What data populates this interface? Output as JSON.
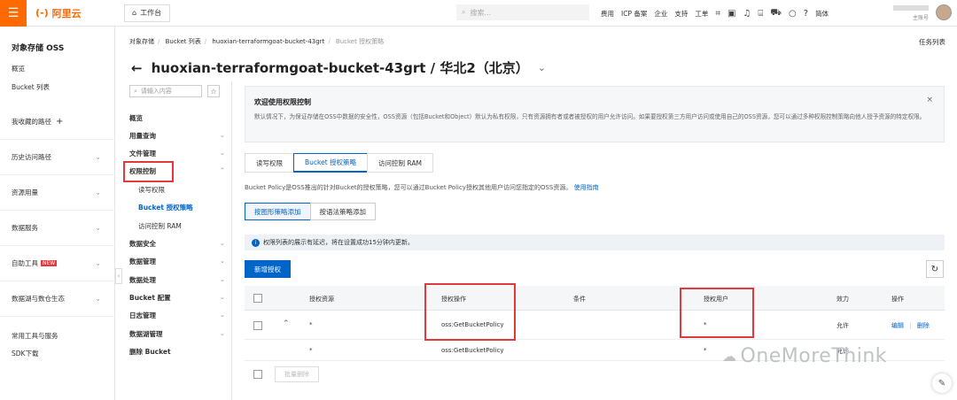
{
  "topbar": {
    "logo_text": "阿里云",
    "logo_mark": "(-)",
    "workbench": "工作台",
    "search_placeholder": "搜索...",
    "nav": [
      "费用",
      "ICP 备案",
      "企业",
      "支持",
      "工单"
    ],
    "lang": "简体",
    "account_sub": "主账号"
  },
  "side1": {
    "title": "对象存储 OSS",
    "items": [
      "概览",
      "Bucket 列表"
    ],
    "groups": [
      {
        "label": "我收藏的路径",
        "suffix": "+"
      },
      {
        "label": "历史访问路径"
      },
      {
        "label": "资源用量"
      },
      {
        "label": "数据服务"
      },
      {
        "label": "自助工具",
        "badge": "NEW"
      },
      {
        "label": "数据湖与数仓生态"
      }
    ],
    "bottom": [
      "常用工具与服务",
      "SDK下载"
    ]
  },
  "breadcrumb": [
    "对象存储",
    "Bucket 列表",
    "huoxian-terraformgoat-bucket-43grt",
    "Bucket 授权策略"
  ],
  "task_list": "任务列表",
  "page_title": "huoxian-terraformgoat-bucket-43grt / 华北2（北京）",
  "side2": {
    "search_placeholder": "请输入内容",
    "items": [
      {
        "label": "概览"
      },
      {
        "label": "用量查询"
      },
      {
        "label": "文件管理"
      },
      {
        "label": "权限控制"
      },
      {
        "label": "数据安全"
      },
      {
        "label": "数据管理"
      },
      {
        "label": "数据处理"
      },
      {
        "label": "Bucket 配置"
      },
      {
        "label": "日志管理"
      },
      {
        "label": "数据湖管理"
      },
      {
        "label": "删除 Bucket"
      }
    ],
    "sub_items": [
      "读写权限",
      "Bucket 授权策略",
      "访问控制 RAM"
    ]
  },
  "welcome": {
    "title": "欢迎使用权限控制",
    "desc": "默认情况下，为保证存储在OSS中数据的安全性，OSS资源（包括Bucket和Object）默认为私有权限，只有资源拥有者或者被授权的用户允许访问。如果要授权第三方用户访问或使用自己的OSS资源，您可以通过多种权限控制策略向他人授予资源的特定权限。"
  },
  "tabs": [
    "读写权限",
    "Bucket 授权策略",
    "访问控制 RAM"
  ],
  "policy_desc": "Bucket Policy是OSS推出的针对Bucket的授权策略，您可以通过Bucket Policy授权其他用户访问您指定的OSS资源。",
  "policy_link": "使用指南",
  "subtabs": [
    "按图形策略添加",
    "按语法策略添加"
  ],
  "notice": "权限列表的展示有延迟，将在设置成功15分钟内更新。",
  "add_button": "新增授权",
  "table": {
    "headers": [
      "授权资源",
      "授权操作",
      "条件",
      "授权用户",
      "效力",
      "操作"
    ],
    "rows": [
      {
        "resource": "*",
        "action": "oss:GetBucketPolicy",
        "condition": "",
        "user": "*",
        "effect": "允许",
        "edit": "编辑",
        "delete": "删除"
      },
      {
        "resource": "*",
        "action": "oss:GetBucketPolicy",
        "condition": "",
        "user": "*",
        "effect": "允许"
      }
    ]
  },
  "bulk_delete": "批量删除",
  "watermark": "OneMoreThink"
}
